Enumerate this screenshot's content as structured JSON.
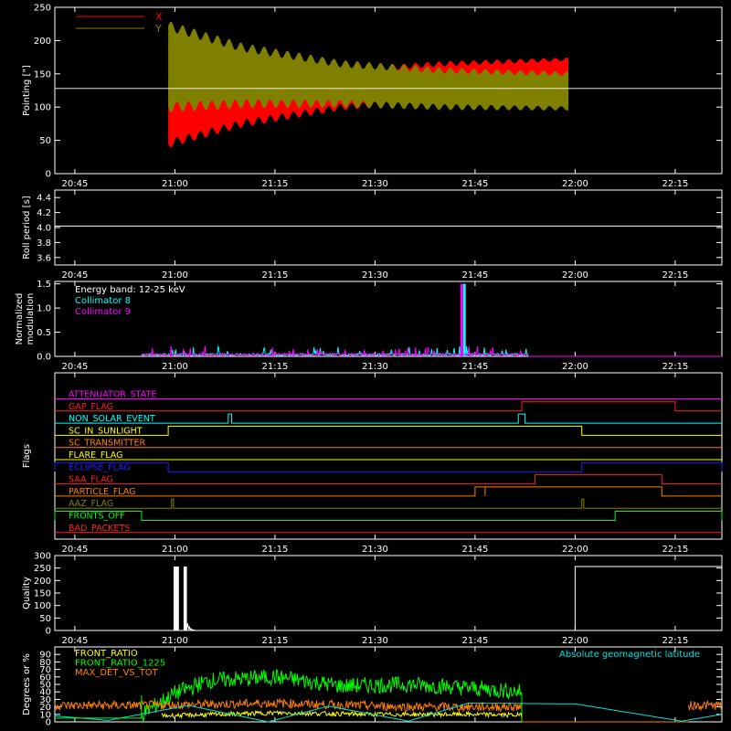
{
  "time_ticks": [
    "20:45",
    "21:00",
    "21:15",
    "21:30",
    "21:45",
    "22:00",
    "22:15"
  ],
  "colors": {
    "background": "#000000",
    "axes": "#ffffff",
    "x_series": "#ff0000",
    "y_series": "#808000",
    "collimator_8": "#00ffff",
    "collimator_9": "#ff00ff",
    "front_ratio": "#ffff00",
    "front_ratio_1225": "#00ff00",
    "max_det_vs_tot": "#ff8000",
    "geomagnetic": "#00e0e0"
  },
  "chart_data": [
    {
      "id": "pointing",
      "type": "area",
      "title": "",
      "xlabel": "",
      "ylabel": "Pointing [\"]",
      "ylim": [
        0,
        250
      ],
      "yticks": [
        "0",
        "50",
        "100",
        "150",
        "200",
        "250"
      ],
      "reference_line": 128,
      "legend": [
        {
          "name": "X",
          "color": "#ff0000"
        },
        {
          "name": "Y",
          "color": "#808000"
        }
      ],
      "legend_position": "top-left",
      "series": [
        {
          "name": "X",
          "time": [
            "20:59",
            "21:10",
            "21:25",
            "21:40",
            "21:59"
          ],
          "upper": [
            140,
            150,
            155,
            165,
            172
          ],
          "lower": [
            45,
            75,
            100,
            110,
            120
          ]
        },
        {
          "name": "Y",
          "time": [
            "20:59",
            "21:10",
            "21:25",
            "21:40",
            "21:59"
          ],
          "upper": [
            222,
            190,
            165,
            155,
            150
          ],
          "lower": [
            100,
            105,
            105,
            100,
            98
          ]
        }
      ]
    },
    {
      "id": "roll_period",
      "type": "line",
      "ylabel": "Roll period [s]",
      "ylim": [
        3.5,
        4.5
      ],
      "yticks": [
        "3.6",
        "3.8",
        "4.0",
        "4.2",
        "4.4"
      ],
      "series": [
        {
          "name": "",
          "time": [
            "20:42",
            "22:22"
          ],
          "values": [
            4.02,
            4.02
          ]
        }
      ]
    },
    {
      "id": "modulation",
      "type": "line",
      "ylabel": "Normalized modulation",
      "ylim": [
        0,
        1.55
      ],
      "yticks": [
        "0.0",
        "0.5",
        "1.0",
        "1.5"
      ],
      "annotations": [
        "Energy band: 12-25 keV",
        "Collimator 8",
        "Collimator 9"
      ],
      "series": [
        {
          "name": "Collimator 8",
          "time_range": [
            "20:55",
            "21:53"
          ],
          "baseline": 0.05,
          "spikes": [
            {
              "time": "21:43.4",
              "value": 1.5
            }
          ]
        },
        {
          "name": "Collimator 9",
          "time_range": [
            "20:55",
            "21:53"
          ],
          "baseline": 0.05,
          "spikes": [
            {
              "time": "21:43.0",
              "value": 1.5
            }
          ]
        }
      ]
    },
    {
      "id": "flags",
      "type": "line",
      "ylabel": "Flags",
      "flags": [
        {
          "name": "ATTENUATOR_STATE",
          "color": "#ff00ff",
          "high": []
        },
        {
          "name": "GAP_FLAG",
          "color": "#ff2020",
          "high": [
            [
              "21:52",
              "22:15"
            ]
          ]
        },
        {
          "name": "NON_SOLAR_EVENT",
          "color": "#00ffff",
          "high": [
            [
              "21:08",
              "21:08.5"
            ],
            [
              "21:51.5",
              "21:52.5"
            ]
          ]
        },
        {
          "name": "SC_IN_SUNLIGHT",
          "color": "#ffff00",
          "high": [
            [
              "20:59",
              "22:01"
            ]
          ]
        },
        {
          "name": "SC_TRANSMITTER",
          "color": "#ff8000",
          "high": []
        },
        {
          "name": "FLARE_FLAG",
          "color": "#ffff00",
          "high": []
        },
        {
          "name": "ECLIPSE_FLAG",
          "color": "#2020ff",
          "high": [
            [
              "20:42",
              "20:59"
            ],
            [
              "22:01",
              "22:22"
            ]
          ]
        },
        {
          "name": "SAA_FLAG",
          "color": "#ff2020",
          "high": [
            [
              "21:54",
              "22:13"
            ]
          ]
        },
        {
          "name": "PARTICLE_FLAG",
          "color": "#ff8000",
          "high": [
            [
              "21:45",
              "21:46.5"
            ],
            [
              "21:46.5",
              "22:13"
            ]
          ]
        },
        {
          "name": "AAZ_FLAG",
          "color": "#808000",
          "high": [
            [
              "20:59.5",
              "20:59.8"
            ],
            [
              "22:01",
              "22:01.3"
            ]
          ]
        },
        {
          "name": "FRONTS_OFF",
          "color": "#00ff00",
          "high": [
            [
              "20:42",
              "20:55"
            ],
            [
              "22:06",
              "22:22"
            ]
          ]
        },
        {
          "name": "BAD_PACKETS",
          "color": "#ff2020",
          "high": []
        }
      ]
    },
    {
      "id": "quality",
      "type": "bar",
      "ylabel": "Quality",
      "ylim": [
        0,
        300
      ],
      "yticks": [
        "0",
        "50",
        "100",
        "150",
        "200",
        "250",
        "300"
      ],
      "series": [
        {
          "name": "",
          "segments": [
            {
              "time": [
                "20:59.8",
                "21:00.6"
              ],
              "value": 256
            },
            {
              "time": [
                "21:01.3",
                "21:01.8"
              ],
              "value": 256
            },
            {
              "time": [
                "22:00",
                "22:22"
              ],
              "value": 256
            }
          ]
        }
      ]
    },
    {
      "id": "front_ratio",
      "type": "line",
      "ylabel": "Degrees or %",
      "ylim": [
        0,
        100
      ],
      "yticks": [
        "0",
        "10",
        "20",
        "30",
        "40",
        "50",
        "60",
        "70",
        "80",
        "90"
      ],
      "legend": [
        {
          "name": "FRONT_RATIO",
          "color": "#ffff00"
        },
        {
          "name": "FRONT_RATIO_1225",
          "color": "#00ff00"
        },
        {
          "name": "MAX_DET_VS_TOT",
          "color": "#ff8000"
        },
        {
          "name": "Absolute geomagnetic latitude",
          "color": "#00e0e0"
        }
      ],
      "series": [
        {
          "name": "FRONT_RATIO_1225",
          "time": [
            "20:55",
            "21:00",
            "21:05",
            "21:15",
            "21:25",
            "21:35",
            "21:45",
            "21:52"
          ],
          "values": [
            10,
            38,
            55,
            60,
            48,
            50,
            45,
            40
          ]
        },
        {
          "name": "MAX_DET_VS_TOT",
          "time": [
            "20:42",
            "20:55",
            "21:15",
            "21:35",
            "21:52",
            "22:17",
            "22:22"
          ],
          "values": [
            22,
            22,
            25,
            20,
            20,
            22,
            22
          ]
        },
        {
          "name": "FRONT_RATIO",
          "time": [
            "20:58",
            "21:15",
            "21:30",
            "21:45",
            "21:52"
          ],
          "values": [
            8,
            12,
            10,
            10,
            9
          ]
        },
        {
          "name": "Absolute geomagnetic latitude",
          "time": [
            "20:42",
            "20:50",
            "21:02",
            "21:14",
            "21:23",
            "21:35",
            "21:44",
            "22:00",
            "22:16",
            "22:22"
          ],
          "values": [
            8,
            2,
            22,
            0,
            21,
            1,
            25,
            24,
            1,
            10
          ]
        }
      ]
    }
  ]
}
